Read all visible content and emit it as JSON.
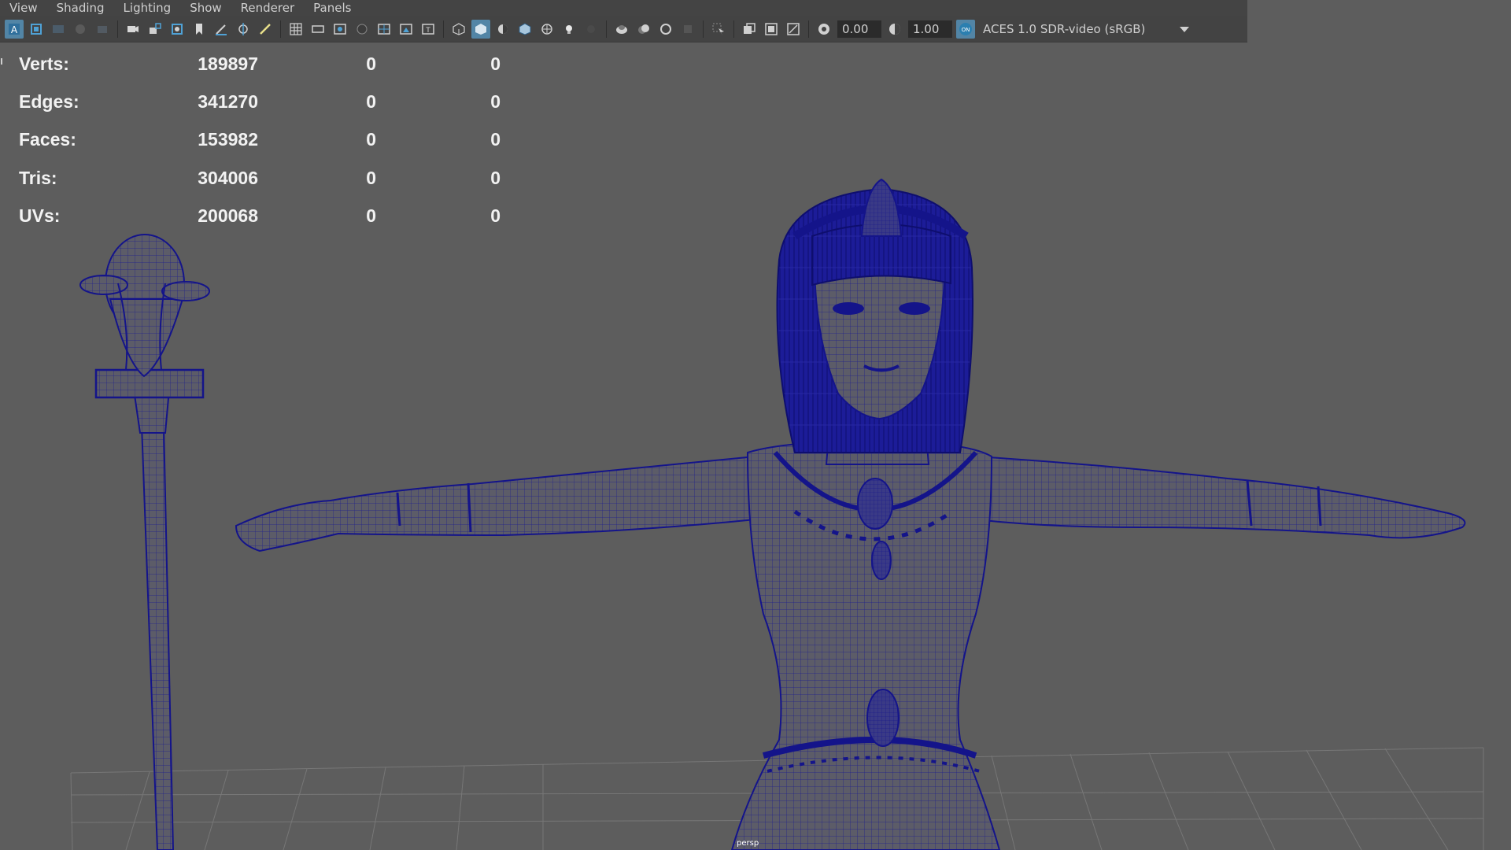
{
  "menu": [
    "View",
    "Shading",
    "Lighting",
    "Show",
    "Renderer",
    "Panels"
  ],
  "toolbar": {
    "exposure_value": "0.00",
    "gamma_value": "1.00",
    "color_management_toggle": "ON",
    "color_space_label": "ACES 1.0 SDR-video (sRGB)"
  },
  "hud": {
    "rows": [
      {
        "label": "Verts:",
        "values": [
          "189897",
          "0",
          "0"
        ]
      },
      {
        "label": "Edges:",
        "values": [
          "341270",
          "0",
          "0"
        ]
      },
      {
        "label": "Faces:",
        "values": [
          "153982",
          "0",
          "0"
        ]
      },
      {
        "label": "Tris:",
        "values": [
          "304006",
          "0",
          "0"
        ]
      },
      {
        "label": "UVs:",
        "values": [
          "200068",
          "0",
          "0"
        ]
      }
    ]
  },
  "viewport": {
    "camera_label": "persp",
    "background_color": "#5d5d5d",
    "wireframe_color": "#1a1a8c",
    "mesh_shade_color": "#5b5b66"
  },
  "colors": {
    "accent": "#5285a6",
    "menubar": "#444444",
    "toolbar": "#434343"
  }
}
